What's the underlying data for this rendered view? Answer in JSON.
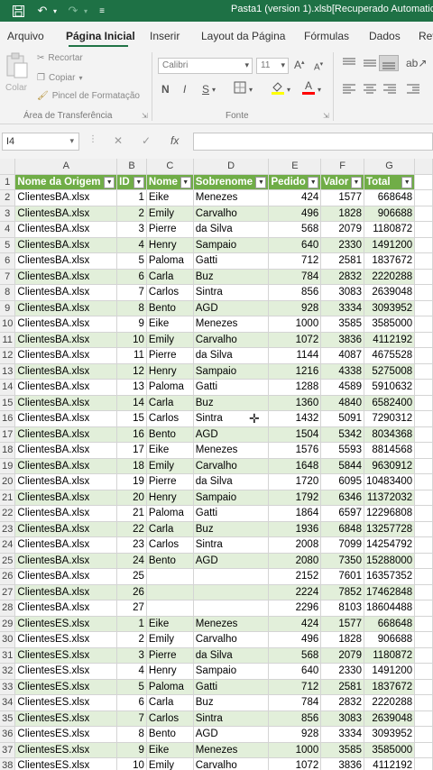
{
  "titlebar": {
    "title": "Pasta1 (version 1).xlsb[Recuperado Automaticam",
    "icons": [
      "save-icon",
      "undo-icon",
      "redo-icon",
      "customize-icon"
    ]
  },
  "tabs": [
    "Arquivo",
    "Página Inicial",
    "Inserir",
    "Layout da Página",
    "Fórmulas",
    "Dados",
    "Rev"
  ],
  "active_tab": "Página Inicial",
  "clipboard": {
    "paste_label": "Colar",
    "cut_label": "Recortar",
    "copy_label": "Copiar",
    "painter_label": "Pincel de Formatação",
    "group_label": "Área de Transferência"
  },
  "font": {
    "name": "Calibri",
    "size": "11",
    "grow": "A",
    "shrink": "A",
    "bold": "N",
    "italic": "I",
    "underline": "S",
    "font_color": "A",
    "group_label": "Fonte"
  },
  "formula_bar": {
    "name_box": "I4",
    "cancel": "✕",
    "enter": "✓",
    "fx": "fx",
    "value": ""
  },
  "columns": [
    "A",
    "B",
    "C",
    "D",
    "E",
    "F",
    "G"
  ],
  "header_row": [
    "Nome da Origem",
    "ID",
    "Nome",
    "Sobrenome",
    "Pedido",
    "Valor",
    "Total"
  ],
  "rows": [
    {
      "n": "2",
      "c": [
        "ClientesBA.xlsx",
        "1",
        "Eike",
        "Menezes",
        "424",
        "1577",
        "668648"
      ]
    },
    {
      "n": "3",
      "c": [
        "ClientesBA.xlsx",
        "2",
        "Emily",
        "Carvalho",
        "496",
        "1828",
        "906688"
      ]
    },
    {
      "n": "4",
      "c": [
        "ClientesBA.xlsx",
        "3",
        "Pierre",
        "da Silva",
        "568",
        "2079",
        "1180872"
      ]
    },
    {
      "n": "5",
      "c": [
        "ClientesBA.xlsx",
        "4",
        "Henry",
        "Sampaio",
        "640",
        "2330",
        "1491200"
      ]
    },
    {
      "n": "6",
      "c": [
        "ClientesBA.xlsx",
        "5",
        "Paloma",
        "Gatti",
        "712",
        "2581",
        "1837672"
      ]
    },
    {
      "n": "7",
      "c": [
        "ClientesBA.xlsx",
        "6",
        "Carla",
        "Buz",
        "784",
        "2832",
        "2220288"
      ]
    },
    {
      "n": "8",
      "c": [
        "ClientesBA.xlsx",
        "7",
        "Carlos",
        "Sintra",
        "856",
        "3083",
        "2639048"
      ]
    },
    {
      "n": "9",
      "c": [
        "ClientesBA.xlsx",
        "8",
        "Bento",
        "AGD",
        "928",
        "3334",
        "3093952"
      ]
    },
    {
      "n": "10",
      "c": [
        "ClientesBA.xlsx",
        "9",
        "Eike",
        "Menezes",
        "1000",
        "3585",
        "3585000"
      ]
    },
    {
      "n": "11",
      "c": [
        "ClientesBA.xlsx",
        "10",
        "Emily",
        "Carvalho",
        "1072",
        "3836",
        "4112192"
      ]
    },
    {
      "n": "12",
      "c": [
        "ClientesBA.xlsx",
        "11",
        "Pierre",
        "da Silva",
        "1144",
        "4087",
        "4675528"
      ]
    },
    {
      "n": "13",
      "c": [
        "ClientesBA.xlsx",
        "12",
        "Henry",
        "Sampaio",
        "1216",
        "4338",
        "5275008"
      ]
    },
    {
      "n": "14",
      "c": [
        "ClientesBA.xlsx",
        "13",
        "Paloma",
        "Gatti",
        "1288",
        "4589",
        "5910632"
      ]
    },
    {
      "n": "15",
      "c": [
        "ClientesBA.xlsx",
        "14",
        "Carla",
        "Buz",
        "1360",
        "4840",
        "6582400"
      ]
    },
    {
      "n": "16",
      "c": [
        "ClientesBA.xlsx",
        "15",
        "Carlos",
        "Sintra",
        "1432",
        "5091",
        "7290312"
      ]
    },
    {
      "n": "17",
      "c": [
        "ClientesBA.xlsx",
        "16",
        "Bento",
        "AGD",
        "1504",
        "5342",
        "8034368"
      ]
    },
    {
      "n": "18",
      "c": [
        "ClientesBA.xlsx",
        "17",
        "Eike",
        "Menezes",
        "1576",
        "5593",
        "8814568"
      ]
    },
    {
      "n": "19",
      "c": [
        "ClientesBA.xlsx",
        "18",
        "Emily",
        "Carvalho",
        "1648",
        "5844",
        "9630912"
      ]
    },
    {
      "n": "20",
      "c": [
        "ClientesBA.xlsx",
        "19",
        "Pierre",
        "da Silva",
        "1720",
        "6095",
        "10483400"
      ]
    },
    {
      "n": "21",
      "c": [
        "ClientesBA.xlsx",
        "20",
        "Henry",
        "Sampaio",
        "1792",
        "6346",
        "11372032"
      ]
    },
    {
      "n": "22",
      "c": [
        "ClientesBA.xlsx",
        "21",
        "Paloma",
        "Gatti",
        "1864",
        "6597",
        "12296808"
      ]
    },
    {
      "n": "23",
      "c": [
        "ClientesBA.xlsx",
        "22",
        "Carla",
        "Buz",
        "1936",
        "6848",
        "13257728"
      ]
    },
    {
      "n": "24",
      "c": [
        "ClientesBA.xlsx",
        "23",
        "Carlos",
        "Sintra",
        "2008",
        "7099",
        "14254792"
      ]
    },
    {
      "n": "25",
      "c": [
        "ClientesBA.xlsx",
        "24",
        "Bento",
        "AGD",
        "2080",
        "7350",
        "15288000"
      ]
    },
    {
      "n": "26",
      "c": [
        "ClientesBA.xlsx",
        "25",
        "",
        "",
        "2152",
        "7601",
        "16357352"
      ]
    },
    {
      "n": "27",
      "c": [
        "ClientesBA.xlsx",
        "26",
        "",
        "",
        "2224",
        "7852",
        "17462848"
      ]
    },
    {
      "n": "28",
      "c": [
        "ClientesBA.xlsx",
        "27",
        "",
        "",
        "2296",
        "8103",
        "18604488"
      ]
    },
    {
      "n": "29",
      "c": [
        "ClientesES.xlsx",
        "1",
        "Eike",
        "Menezes",
        "424",
        "1577",
        "668648"
      ]
    },
    {
      "n": "30",
      "c": [
        "ClientesES.xlsx",
        "2",
        "Emily",
        "Carvalho",
        "496",
        "1828",
        "906688"
      ]
    },
    {
      "n": "31",
      "c": [
        "ClientesES.xlsx",
        "3",
        "Pierre",
        "da Silva",
        "568",
        "2079",
        "1180872"
      ]
    },
    {
      "n": "32",
      "c": [
        "ClientesES.xlsx",
        "4",
        "Henry",
        "Sampaio",
        "640",
        "2330",
        "1491200"
      ]
    },
    {
      "n": "33",
      "c": [
        "ClientesES.xlsx",
        "5",
        "Paloma",
        "Gatti",
        "712",
        "2581",
        "1837672"
      ]
    },
    {
      "n": "34",
      "c": [
        "ClientesES.xlsx",
        "6",
        "Carla",
        "Buz",
        "784",
        "2832",
        "2220288"
      ]
    },
    {
      "n": "35",
      "c": [
        "ClientesES.xlsx",
        "7",
        "Carlos",
        "Sintra",
        "856",
        "3083",
        "2639048"
      ]
    },
    {
      "n": "36",
      "c": [
        "ClientesES.xlsx",
        "8",
        "Bento",
        "AGD",
        "928",
        "3334",
        "3093952"
      ]
    },
    {
      "n": "37",
      "c": [
        "ClientesES.xlsx",
        "9",
        "Eike",
        "Menezes",
        "1000",
        "3585",
        "3585000"
      ]
    },
    {
      "n": "38",
      "c": [
        "ClientesES.xlsx",
        "10",
        "Emily",
        "Carvalho",
        "1072",
        "3836",
        "4112192"
      ]
    }
  ],
  "colors": {
    "title_bar": "#1e7145",
    "table_header": "#70ad47",
    "band": "#e2efda",
    "accent": "#217346"
  }
}
